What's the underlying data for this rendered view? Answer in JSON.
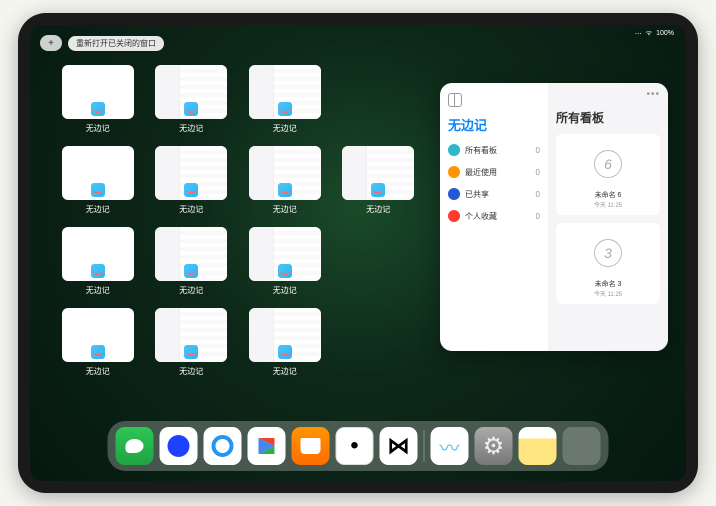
{
  "status": {
    "signal": "⋯",
    "wifi": "ᯤ",
    "battery": "100%"
  },
  "topbar": {
    "plus": "+",
    "reopen": "重新打开已关闭的窗口"
  },
  "app_name": "无边记",
  "windows": [
    {
      "style": "blank"
    },
    {
      "style": "columns"
    },
    {
      "style": "columns"
    },
    {
      "style": "blank"
    },
    {
      "style": "columns"
    },
    {
      "style": "columns"
    },
    {
      "style": "columns"
    },
    {
      "style": "blank"
    },
    {
      "style": "columns"
    },
    {
      "style": "columns"
    },
    {
      "style": "blank"
    },
    {
      "style": "columns"
    },
    {
      "style": "columns"
    }
  ],
  "slideover": {
    "title": "无边记",
    "items": [
      {
        "label": "所有看板",
        "count": "0",
        "color": "#2fb8c5"
      },
      {
        "label": "最近使用",
        "count": "0",
        "color": "#ff9500"
      },
      {
        "label": "已共享",
        "count": "0",
        "color": "#2557d6"
      },
      {
        "label": "个人收藏",
        "count": "0",
        "color": "#ff3b30"
      }
    ],
    "right_title": "所有看板",
    "more": "•••",
    "boards": [
      {
        "num": "6",
        "label": "未命名 6",
        "time": "今天 11:25"
      },
      {
        "num": "3",
        "label": "未命名 3",
        "time": "今天 11:25"
      }
    ]
  },
  "dock": [
    {
      "name": "wechat"
    },
    {
      "name": "qq-blue"
    },
    {
      "name": "qbrowser"
    },
    {
      "name": "play"
    },
    {
      "name": "books"
    },
    {
      "name": "dice"
    },
    {
      "name": "bowtie"
    },
    {
      "name": "freeform"
    },
    {
      "name": "settings"
    },
    {
      "name": "notes"
    },
    {
      "name": "app-lib"
    }
  ]
}
